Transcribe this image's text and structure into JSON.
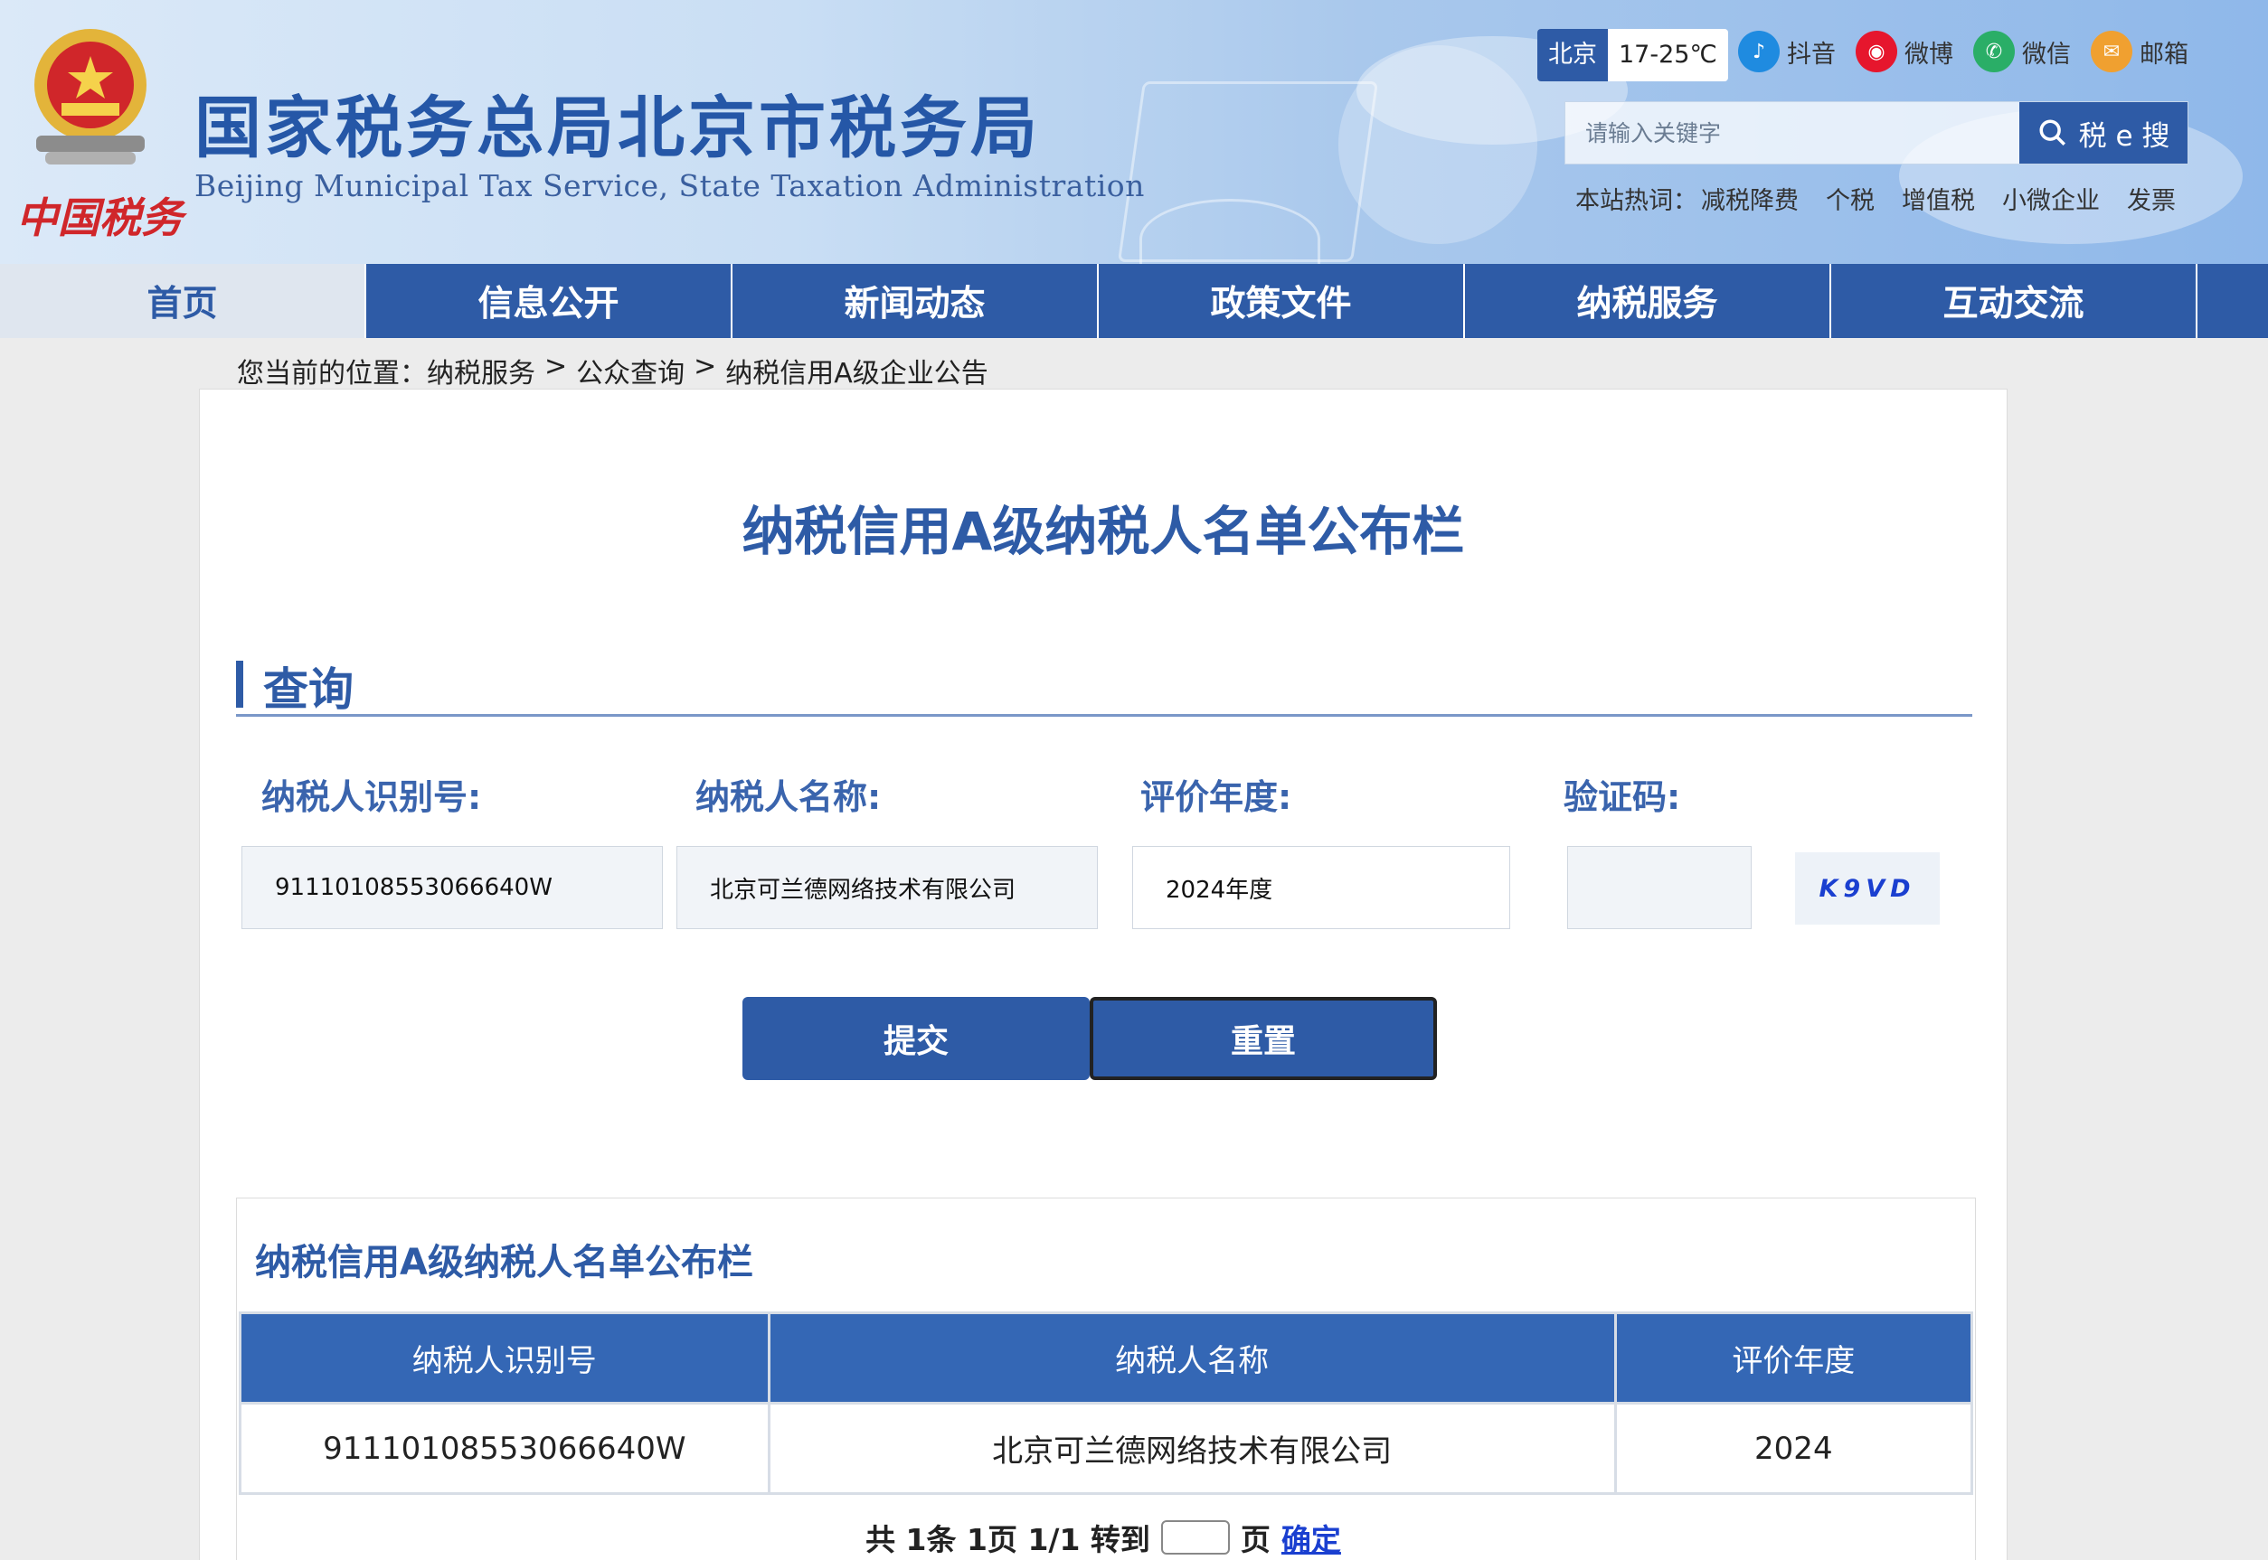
{
  "header": {
    "title_cn": "国家税务总局北京市税务局",
    "title_en": "Beijing Municipal Tax Service, State Taxation Administration",
    "logo_cn": "中国税务",
    "weather": {
      "city": "北京",
      "temp": "17-25℃"
    },
    "social": [
      {
        "label": "抖音",
        "icon": "douyin-icon",
        "color": "#1f8be0"
      },
      {
        "label": "微博",
        "icon": "weibo-icon",
        "color": "#e6162d"
      },
      {
        "label": "微信",
        "icon": "wechat-icon",
        "color": "#2aae67"
      },
      {
        "label": "邮箱",
        "icon": "mail-icon",
        "color": "#f0a030"
      }
    ],
    "search": {
      "placeholder": "请输入关键字",
      "button": "税 e 搜"
    },
    "hot": {
      "label": "本站热词：",
      "items": [
        "减税降费",
        "个税",
        "增值税",
        "小微企业",
        "发票"
      ]
    }
  },
  "nav": [
    "首页",
    "信息公开",
    "新闻动态",
    "政策文件",
    "纳税服务",
    "互动交流"
  ],
  "breadcrumb": {
    "label": "您当前的位置：",
    "items": [
      "纳税服务",
      "公众查询",
      "纳税信用A级企业公告"
    ],
    "sep": ">"
  },
  "main": {
    "title": "纳税信用A级纳税人名单公布栏",
    "section": "查询",
    "fields": {
      "id_label": "纳税人识别号:",
      "id_value": "91110108553066640W",
      "name_label": "纳税人名称:",
      "name_value": "北京可兰德网络技术有限公司",
      "year_label": "评价年度:",
      "year_value": "2024年度",
      "captcha_label": "验证码:",
      "captcha_value": "",
      "captcha_image": "K9VD"
    },
    "buttons": {
      "submit": "提交",
      "reset": "重置"
    }
  },
  "results": {
    "title": "纳税信用A级纳税人名单公布栏",
    "columns": [
      "纳税人识别号",
      "纳税人名称",
      "评价年度"
    ],
    "rows": [
      [
        "91110108553066640W",
        "北京可兰德网络技术有限公司",
        "2024"
      ]
    ],
    "pager": {
      "text": "共 1条 1页 1/1 转到",
      "page": "页",
      "confirm": "确定"
    }
  },
  "colors": {
    "brand": "#2e5ba6",
    "nav_active_bg": "#dfe6ef"
  }
}
